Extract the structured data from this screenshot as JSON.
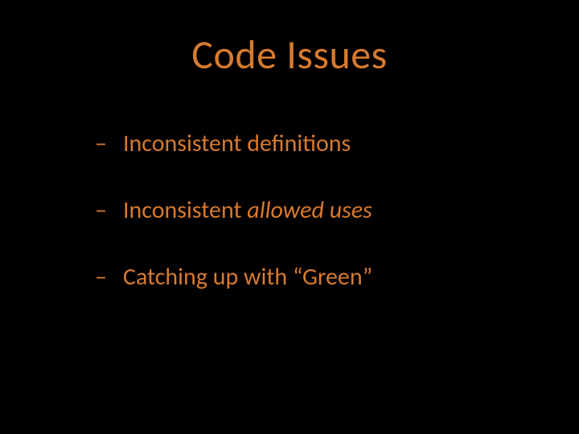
{
  "slide": {
    "title": "Code Issues",
    "bullets": [
      {
        "dash": "–",
        "pre": "Inconsistent definitions",
        "italic": "",
        "post": ""
      },
      {
        "dash": "–",
        "pre": "Inconsistent ",
        "italic": "allowed uses",
        "post": ""
      },
      {
        "dash": "–",
        "pre": "Catching up with “Green”",
        "italic": "",
        "post": ""
      }
    ]
  }
}
